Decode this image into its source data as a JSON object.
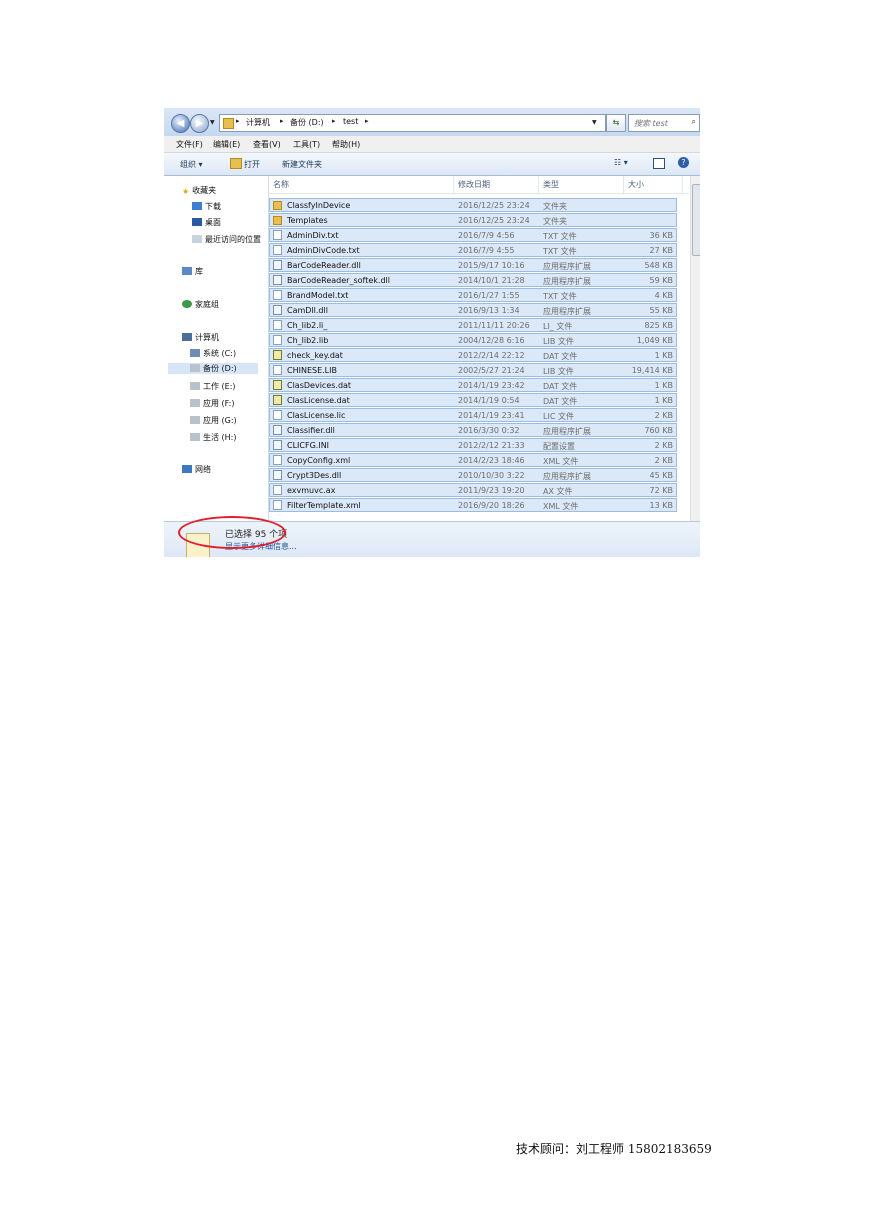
{
  "window": {
    "path": [
      "计算机",
      "备份 (D:)",
      "test"
    ],
    "search_placeholder": "搜索 test",
    "menu": [
      "文件(F)",
      "编辑(E)",
      "查看(V)",
      "工具(T)",
      "帮助(H)"
    ],
    "toolbar": {
      "organize": "组织 ▾",
      "open": "打开",
      "new_folder": "新建文件夹"
    },
    "nav": {
      "favorites": "收藏夹",
      "favorites_items": [
        "下载",
        "桌面",
        "最近访问的位置"
      ],
      "libraries": "库",
      "homegroup": "家庭组",
      "computer": "计算机",
      "drives": [
        "系统 (C:)",
        "备份 (D:)",
        "工作 (E:)",
        "应用 (F:)",
        "应用 (G:)",
        "生活 (H:)"
      ],
      "network": "网络"
    },
    "columns": [
      "名称",
      "修改日期",
      "类型",
      "大小"
    ],
    "files": [
      {
        "name": "ClassfyInDevice",
        "date": "2016/12/25 23:24",
        "type": "文件夹",
        "size": "",
        "icon": "folder-icon"
      },
      {
        "name": "Templates",
        "date": "2016/12/25 23:24",
        "type": "文件夹",
        "size": "",
        "icon": "folder-icon"
      },
      {
        "name": "AdminDiv.txt",
        "date": "2016/7/9 4:56",
        "type": "TXT 文件",
        "size": "36 KB",
        "icon": "text-file-icon"
      },
      {
        "name": "AdminDivCode.txt",
        "date": "2016/7/9 4:55",
        "type": "TXT 文件",
        "size": "27 KB",
        "icon": "text-file-icon"
      },
      {
        "name": "BarCodeReader.dll",
        "date": "2015/9/17 10:16",
        "type": "应用程序扩展",
        "size": "548 KB",
        "icon": "dll-icon"
      },
      {
        "name": "BarCodeReader_softek.dll",
        "date": "2014/10/1 21:28",
        "type": "应用程序扩展",
        "size": "59 KB",
        "icon": "dll-icon"
      },
      {
        "name": "BrandModel.txt",
        "date": "2016/1/27 1:55",
        "type": "TXT 文件",
        "size": "4 KB",
        "icon": "text-file-icon"
      },
      {
        "name": "CamDll.dll",
        "date": "2016/9/13 1:34",
        "type": "应用程序扩展",
        "size": "55 KB",
        "icon": "dll-icon"
      },
      {
        "name": "Ch_lib2.li_",
        "date": "2011/11/11 20:26",
        "type": "LI_ 文件",
        "size": "825 KB",
        "icon": "file-icon"
      },
      {
        "name": "Ch_lib2.lib",
        "date": "2004/12/28 6:16",
        "type": "LIB 文件",
        "size": "1,049 KB",
        "icon": "file-icon"
      },
      {
        "name": "check_key.dat",
        "date": "2012/2/14 22:12",
        "type": "DAT 文件",
        "size": "1 KB",
        "icon": "dat-icon"
      },
      {
        "name": "CHINESE.LIB",
        "date": "2002/5/27 21:24",
        "type": "LIB 文件",
        "size": "19,414 KB",
        "icon": "file-icon"
      },
      {
        "name": "ClasDevices.dat",
        "date": "2014/1/19 23:42",
        "type": "DAT 文件",
        "size": "1 KB",
        "icon": "dat-icon"
      },
      {
        "name": "ClasLicense.dat",
        "date": "2014/1/19 0:54",
        "type": "DAT 文件",
        "size": "1 KB",
        "icon": "dat-icon"
      },
      {
        "name": "ClasLicense.lic",
        "date": "2014/1/19 23:41",
        "type": "LIC 文件",
        "size": "2 KB",
        "icon": "file-icon"
      },
      {
        "name": "Classifier.dll",
        "date": "2016/3/30 0:32",
        "type": "应用程序扩展",
        "size": "760 KB",
        "icon": "dll-icon"
      },
      {
        "name": "CLICFG.INI",
        "date": "2012/2/12 21:33",
        "type": "配置设置",
        "size": "2 KB",
        "icon": "dll-icon"
      },
      {
        "name": "CopyConfig.xml",
        "date": "2014/2/23 18:46",
        "type": "XML 文件",
        "size": "2 KB",
        "icon": "file-icon"
      },
      {
        "name": "Crypt3Des.dll",
        "date": "2010/10/30 3:22",
        "type": "应用程序扩展",
        "size": "45 KB",
        "icon": "dll-icon"
      },
      {
        "name": "exvmuvc.ax",
        "date": "2011/9/23 19:20",
        "type": "AX 文件",
        "size": "72 KB",
        "icon": "file-icon"
      },
      {
        "name": "FilterTemplate.xml",
        "date": "2016/9/20 18:26",
        "type": "XML 文件",
        "size": "13 KB",
        "icon": "file-icon"
      }
    ],
    "status": {
      "selected": "已选择 95 个项",
      "more": "显示更多详细信息..."
    }
  },
  "footer": "技术顾问：刘工程师 15802183659",
  "colors": {
    "selection": "#dbe8f8",
    "selection_border": "#9bbce0",
    "annotation_ring": "#e0202a"
  }
}
